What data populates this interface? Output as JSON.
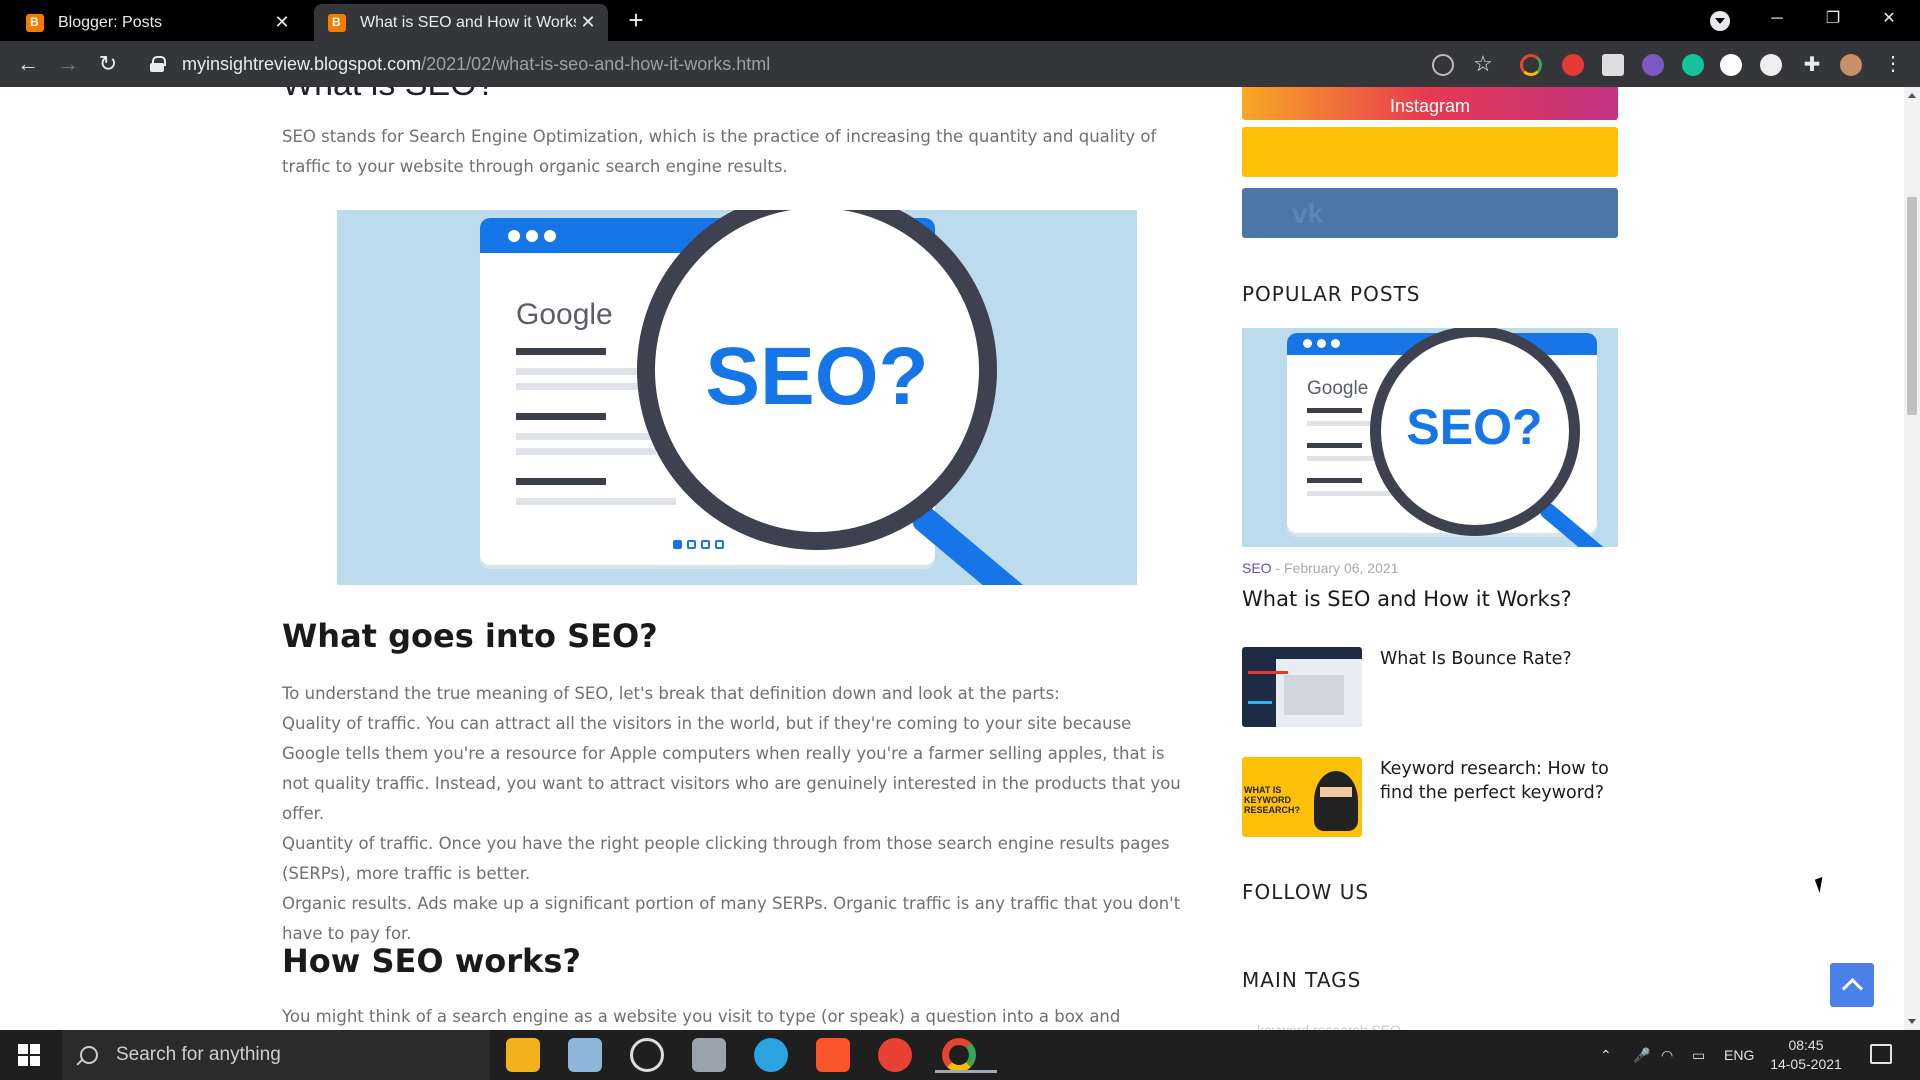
{
  "browser": {
    "tabs": [
      {
        "label": "Blogger: Posts",
        "active": false
      },
      {
        "label": "What is SEO and How it Works?",
        "active": true
      }
    ],
    "url_host": "myinsightreview.blogspot.com",
    "url_path": "/2021/02/what-is-seo-and-how-it-works.html",
    "window_controls": {
      "minimize": "─",
      "restore": "❐",
      "close": "✕"
    }
  },
  "article": {
    "partial_heading": "What is SEO?",
    "intro": "SEO stands for Search Engine Optimization, which is the practice of increasing the quantity and quality of traffic to your website through organic search engine results.",
    "hero": {
      "brand": "Google",
      "badge": "SEO?"
    },
    "section1_title": "What goes into SEO?",
    "section1_paragraphs": [
      "To understand the true meaning of SEO, let's break that definition down and look at the parts:",
      "Quality of traffic. You can attract all the visitors in the world, but if they're coming to your site because Google tells them you're a resource for Apple computers when really you're a farmer selling apples, that is not quality traffic. Instead, you want to attract visitors who are genuinely interested in the products that you offer.",
      "Quantity of traffic. Once you have the right people clicking through from those search engine results pages (SERPs), more traffic is better.",
      "Organic results. Ads make up a significant portion of many SERPs. Organic traffic is any traffic that you don't have to pay for."
    ],
    "section2_title": "How SEO works?",
    "section2_intro": "You might think of a search engine as a website you visit to type (or speak) a question into a box and"
  },
  "sidebar": {
    "instagram_label": "Instagram",
    "popular_posts_title": "POPULAR POSTS",
    "featured": {
      "brand": "Google",
      "badge": "SEO?",
      "tag": "SEO",
      "date": "February 06, 2021",
      "title": "What is SEO and How it Works?"
    },
    "posts": [
      {
        "title": "What Is Bounce Rate?"
      },
      {
        "title": "Keyword research: How to find the perfect keyword?",
        "thumb_text": "WHAT IS KEYWORD RESEARCH?"
      }
    ],
    "follow_title": "FOLLOW US",
    "tags_title": "MAIN TAGS",
    "tags_partial": "keyword research     SEO"
  },
  "taskbar": {
    "search_placeholder": "Search for anything",
    "lang": "ENG",
    "time": "08:45",
    "date": "14-05-2021"
  },
  "colors": {
    "accent": "#1676e8",
    "tag": "#5b4fc4",
    "yellow": "#ffc107",
    "vk": "#4a76a8"
  }
}
